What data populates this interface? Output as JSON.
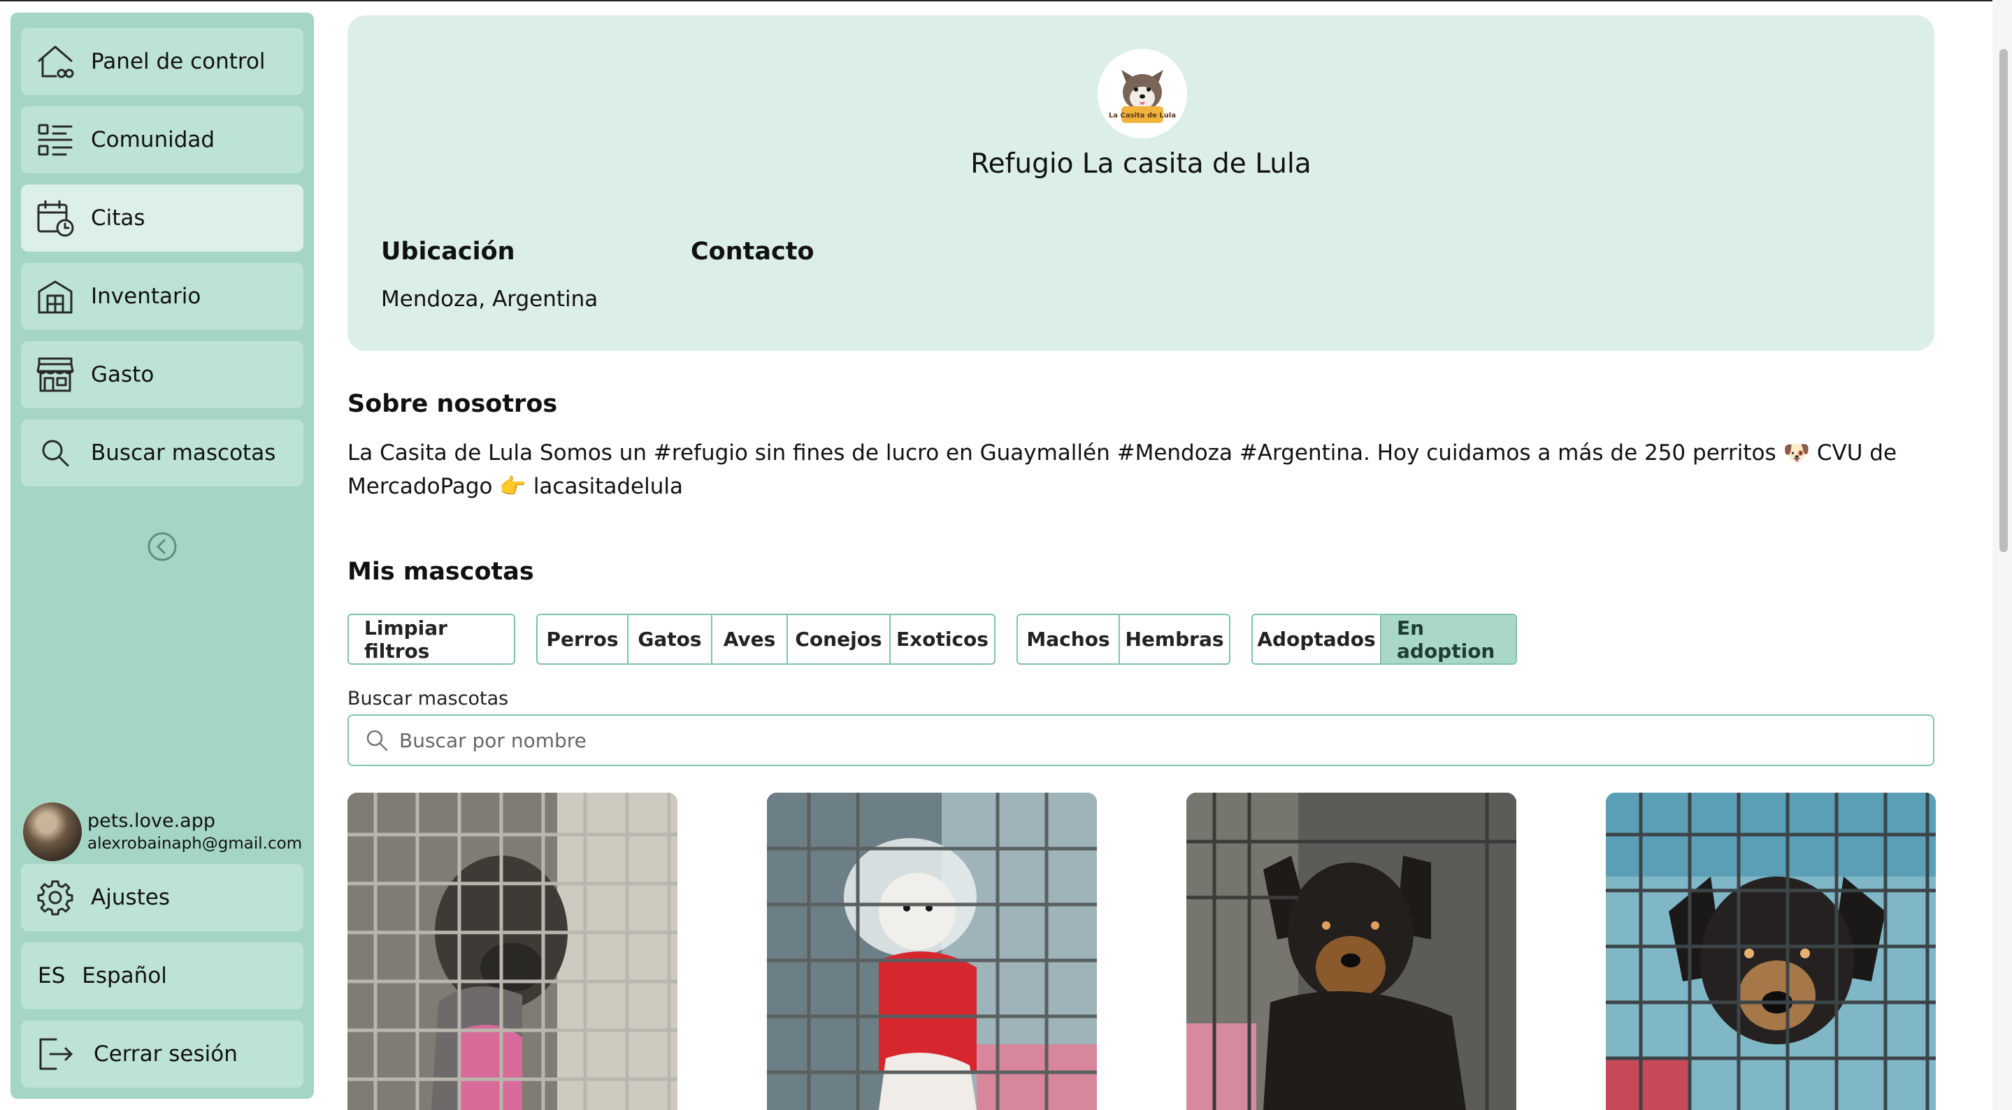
{
  "sidebar": {
    "items": [
      {
        "label": "Panel de control",
        "icon": "home-icon"
      },
      {
        "label": "Comunidad",
        "icon": "list-icon"
      },
      {
        "label": "Citas",
        "icon": "calendar-clock-icon"
      },
      {
        "label": "Inventario",
        "icon": "building-icon"
      },
      {
        "label": "Gasto",
        "icon": "store-icon"
      },
      {
        "label": "Buscar mascotas",
        "icon": "search-icon"
      }
    ],
    "active_item": "Citas",
    "collapse_icon": "chevron-left-circle-icon",
    "user": {
      "name": "pets.love.app",
      "email": "alexrobainaph@gmail.com"
    },
    "settings_label": "Ajustes",
    "language": {
      "code": "ES",
      "label": "Español"
    },
    "logout_label": "Cerrar sesión"
  },
  "profile": {
    "logo_text": "La Casita de Lula",
    "name": "Refugio La casita de Lula",
    "location_label": "Ubicación",
    "location_value": "Mendoza, Argentina",
    "contact_label": "Contacto"
  },
  "about": {
    "title": "Sobre nosotros",
    "text": "La Casita de Lula Somos un #refugio sin fines de lucro en Guaymallén #Mendoza #Argentina. Hoy cuidamos a más de 250 perritos 🐶 CVU de MercadoPago 👉 lacasitadelula"
  },
  "pets": {
    "title": "Mis mascotas",
    "clear_filters": "Limpiar filtros",
    "species_filters": [
      "Perros",
      "Gatos",
      "Aves",
      "Conejos",
      "Exoticos"
    ],
    "sex_filters": [
      "Machos",
      "Hembras"
    ],
    "status_filters": [
      "Adoptados",
      "En adoption"
    ],
    "selected_status": "En adoption",
    "search_label": "Buscar mascotas",
    "search_placeholder": "Buscar por nombre"
  },
  "colors": {
    "sidebar_bg": "#a5d5c4",
    "nav_item_bg": "#bde3d5",
    "nav_active_bg": "#dcf0e8",
    "card_bg": "#dcefe7",
    "accent_border": "#7fc2ad",
    "selected_filter_bg": "#a9d9c6"
  }
}
